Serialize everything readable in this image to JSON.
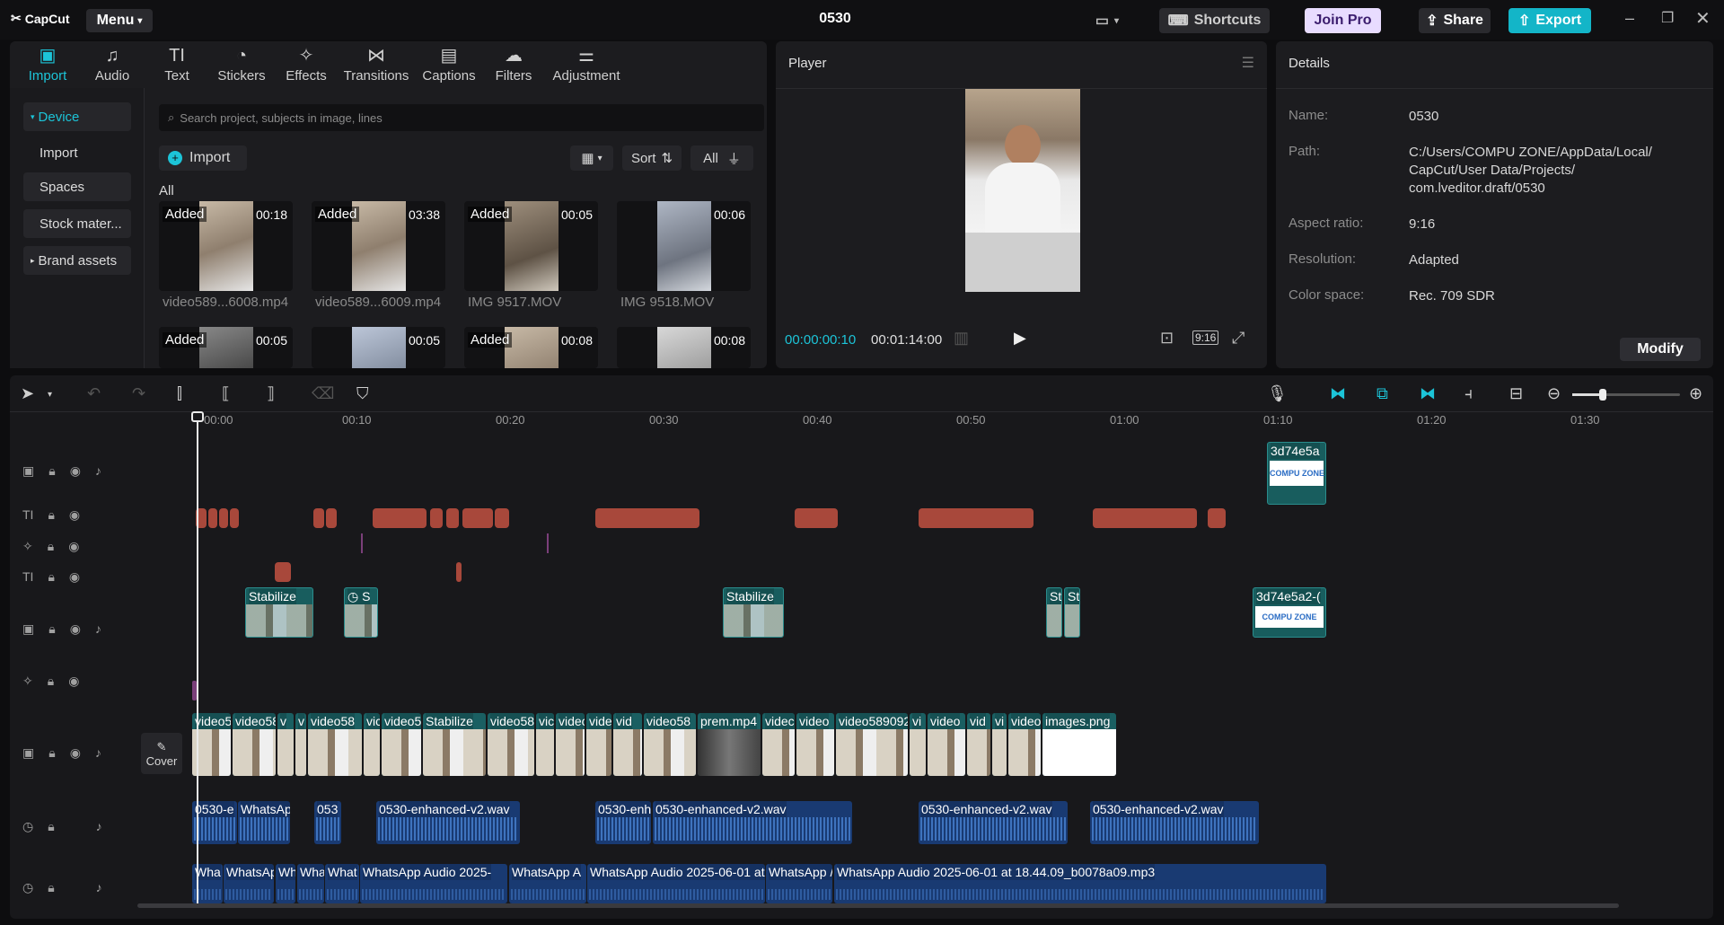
{
  "titlebar": {
    "app_name": "CapCut",
    "menu_label": "Menu",
    "project_title": "0530",
    "shortcuts_label": "Shortcuts",
    "join_pro_label": "Join Pro",
    "share_label": "Share",
    "export_label": "Export"
  },
  "media_tabs": [
    {
      "label": "Import",
      "icon": "import-icon"
    },
    {
      "label": "Audio",
      "icon": "audio-icon"
    },
    {
      "label": "Text",
      "icon": "text-icon"
    },
    {
      "label": "Stickers",
      "icon": "stickers-icon"
    },
    {
      "label": "Effects",
      "icon": "effects-icon"
    },
    {
      "label": "Transitions",
      "icon": "transitions-icon"
    },
    {
      "label": "Captions",
      "icon": "captions-icon"
    },
    {
      "label": "Filters",
      "icon": "filters-icon"
    },
    {
      "label": "Adjustment",
      "icon": "adjustment-icon"
    }
  ],
  "media_sidebar": [
    "Device",
    "Import",
    "Spaces",
    "Stock mater...",
    "Brand assets"
  ],
  "media": {
    "search_placeholder": "Search project, subjects in image, lines",
    "import_label": "Import",
    "sort_label": "Sort",
    "filter_label": "All",
    "section_label": "All",
    "added_badge": "Added",
    "items": [
      {
        "name": "video589...6008.mp4",
        "duration": "00:18",
        "added": true
      },
      {
        "name": "video589...6009.mp4",
        "duration": "03:38",
        "added": true
      },
      {
        "name": "IMG 9517.MOV",
        "duration": "00:05",
        "added": true
      },
      {
        "name": "IMG 9518.MOV",
        "duration": "00:06",
        "added": false
      },
      {
        "name": "",
        "duration": "00:05",
        "added": true
      },
      {
        "name": "",
        "duration": "00:05",
        "added": false
      },
      {
        "name": "",
        "duration": "00:08",
        "added": true
      },
      {
        "name": "",
        "duration": "00:08",
        "added": false
      }
    ]
  },
  "player": {
    "title": "Player",
    "current_time": "00:00:00:10",
    "total_time": "00:01:14:00",
    "ratio_label": "9:16"
  },
  "details": {
    "title": "Details",
    "rows": [
      {
        "label": "Name:",
        "value": "0530"
      },
      {
        "label": "Path:",
        "value": "C:/Users/COMPU ZONE/AppData/Local/\nCapCut/User Data/Projects/\ncom.lveditor.draft/0530"
      },
      {
        "label": "Aspect ratio:",
        "value": "9:16"
      },
      {
        "label": "Resolution:",
        "value": "Adapted"
      },
      {
        "label": "Color space:",
        "value": "Rec. 709 SDR"
      }
    ],
    "modify_label": "Modify"
  },
  "timeline": {
    "ruler": [
      "00:00",
      "00:10",
      "00:20",
      "00:30",
      "00:40",
      "00:50",
      "01:00",
      "01:10",
      "01:20",
      "01:30"
    ],
    "cover_label": "Cover",
    "video_clips": [
      "video5",
      "video58",
      "v",
      "v",
      "video58",
      "vic",
      "video5",
      "Stabilize",
      "video58",
      "vic",
      "videc",
      "vide",
      "vid",
      "video58",
      "prem.mp4",
      "videc",
      "video",
      "video589092",
      "vi",
      "video",
      "vid",
      "vi",
      "video",
      "images.png"
    ],
    "overlay_clips": [
      "Stabilize",
      "S",
      "Stabilize",
      "St",
      "St",
      "3d74e5a2-("
    ],
    "top_clip": "3d74e5a",
    "audio_clips_1": [
      "0530-e",
      "WhatsAp",
      "053",
      "0530-enhanced-v2.wav",
      "0530-enh",
      "0530-enhanced-v2.wav",
      "0530-enhanced-v2.wav",
      "0530-enhanced-v2.wav"
    ],
    "audio_clips_2": [
      "Wha",
      "WhatsApp",
      "Wh",
      "Wha",
      "What",
      "WhatsApp Audio 2025-",
      "WhatsApp A",
      "WhatsApp Audio 2025-06-01 at 18.44.09",
      "WhatsApp /",
      "WhatsApp Audio 2025-06-01 at 18.44.09_b0078a09.mp3"
    ],
    "logo_text": "COMPU ZONE"
  },
  "colors": {
    "accent": "#1cc4d8",
    "join_pro_bg": "#e8dcff",
    "export_bg": "#13b5c8",
    "video_clip": "#1a5f62",
    "audio_clip": "#193a72",
    "text_clip": "#a8483b"
  }
}
